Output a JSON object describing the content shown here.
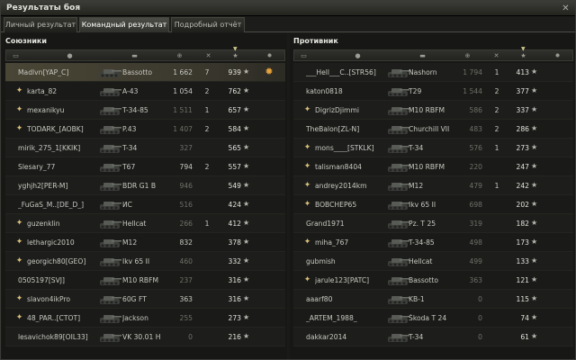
{
  "window": {
    "title": "Результаты боя"
  },
  "tabs": [
    "Личный результат",
    "Командный результат",
    "Подробный отчёт"
  ],
  "active_tab": 1,
  "allies": {
    "title": "Союзники",
    "rows": [
      {
        "name": "Madlvn[YAP_C]",
        "tank": "Bassotto",
        "damage": "1 662",
        "kills": "7",
        "xp": "939",
        "medal": true,
        "me": true
      },
      {
        "name": "karta_82",
        "badge": true,
        "tank": "A-43",
        "damage": "1 054",
        "kills": "2",
        "xp": "762"
      },
      {
        "name": "mexanikyu",
        "badge": true,
        "tank": "T-34-85",
        "damage": "1 511",
        "damage_dim": true,
        "kills": "1",
        "xp": "657"
      },
      {
        "name": "TODARK_[AOBK]",
        "badge": true,
        "tank": "P.43",
        "damage": "1 407",
        "damage_dim": true,
        "kills": "2",
        "xp": "584"
      },
      {
        "name": "mirik_275_1[KKIK]",
        "tank": "T-34",
        "damage": "327",
        "damage_dim": true,
        "kills": "",
        "xp": "565"
      },
      {
        "name": "Slesary_77",
        "tank": "T67",
        "damage": "794",
        "kills": "2",
        "xp": "557"
      },
      {
        "name": "yghjh2[PER-M]",
        "tank": "BDR G1 B",
        "damage": "946",
        "damage_dim": true,
        "kills": "",
        "xp": "549"
      },
      {
        "name": "_FuGaS_M..[DE_D_]",
        "tank": "ИС",
        "damage": "516",
        "damage_dim": true,
        "kills": "",
        "xp": "424"
      },
      {
        "name": "guzenklin",
        "badge": true,
        "tank": "Hellcat",
        "damage": "266",
        "damage_dim": true,
        "kills": "1",
        "xp": "412"
      },
      {
        "name": "lethargic2010",
        "badge": true,
        "tank": "M12",
        "damage": "832",
        "kills": "",
        "xp": "378"
      },
      {
        "name": "georgich80[GEO]",
        "badge": true,
        "tank": "Ikv 65 II",
        "damage": "460",
        "damage_dim": true,
        "kills": "",
        "xp": "332"
      },
      {
        "name": "0505197[SVJ]",
        "tank": "M10 RBFM",
        "damage": "237",
        "damage_dim": true,
        "kills": "",
        "xp": "316"
      },
      {
        "name": "slavon4ikPro",
        "badge": true,
        "tank": "60G FT",
        "damage": "363",
        "kills": "",
        "xp": "316"
      },
      {
        "name": "48_PAR..[CTOT]",
        "badge": true,
        "tank": "Jackson",
        "damage": "255",
        "damage_dim": true,
        "kills": "",
        "xp": "273"
      },
      {
        "name": "lesavichok89[OIL33]",
        "tank": "VK 30.01 H",
        "damage": "0",
        "damage_dim": true,
        "kills": "",
        "xp": "216"
      }
    ]
  },
  "enemies": {
    "title": "Противник",
    "rows": [
      {
        "name": "___Hell___C..[STR56]",
        "tank": "Nashorn",
        "damage": "1 794",
        "damage_dim": true,
        "kills": "1",
        "xp": "413"
      },
      {
        "name": "katon0818",
        "tank": "T29",
        "damage": "1 544",
        "damage_dim": true,
        "kills": "2",
        "xp": "377"
      },
      {
        "name": "DigrizDjimmi",
        "badge": true,
        "tank": "M10 RBFM",
        "damage": "586",
        "damage_dim": true,
        "kills": "2",
        "xp": "337"
      },
      {
        "name": "TheBalon[ZL-N]",
        "tank": "Churchill VII",
        "damage": "483",
        "damage_dim": true,
        "kills": "2",
        "xp": "286"
      },
      {
        "name": "mons____[STKLK]",
        "badge": true,
        "tank": "T-34",
        "damage": "576",
        "damage_dim": true,
        "kills": "1",
        "xp": "273"
      },
      {
        "name": "talisman8404",
        "badge": true,
        "tank": "M10 RBFM",
        "damage": "220",
        "damage_dim": true,
        "kills": "",
        "xp": "247"
      },
      {
        "name": "andrey2014km",
        "badge": true,
        "tank": "M12",
        "damage": "479",
        "damage_dim": true,
        "kills": "1",
        "xp": "242"
      },
      {
        "name": "BOBCHEP65",
        "badge": true,
        "tank": "Ikv 65 II",
        "damage": "698",
        "damage_dim": true,
        "kills": "",
        "xp": "202"
      },
      {
        "name": "Grand1971",
        "tank": "Pz. T 25",
        "damage": "319",
        "damage_dim": true,
        "kills": "",
        "xp": "182"
      },
      {
        "name": "miha_767",
        "badge": true,
        "tank": "T-34-85",
        "damage": "498",
        "damage_dim": true,
        "kills": "",
        "xp": "173"
      },
      {
        "name": "gubmish",
        "tank": "Hellcat",
        "damage": "499",
        "damage_dim": true,
        "kills": "",
        "xp": "133"
      },
      {
        "name": "jarule123[PATC]",
        "badge": true,
        "tank": "Bassotto",
        "damage": "363",
        "damage_dim": true,
        "kills": "",
        "xp": "121"
      },
      {
        "name": "aaarf80",
        "tank": "KB-1",
        "damage": "0",
        "damage_dim": true,
        "kills": "",
        "xp": "115"
      },
      {
        "name": "_ARTEM_1988_",
        "tank": "Škoda T 24",
        "damage": "0",
        "damage_dim": true,
        "kills": "",
        "xp": "74"
      },
      {
        "name": "dakkar2014",
        "tank": "T-34",
        "damage": "0",
        "damage_dim": true,
        "kills": "",
        "xp": "61"
      }
    ]
  },
  "icons": {
    "star": "★",
    "close": "✕",
    "medal": "✹",
    "badge": "✦"
  }
}
